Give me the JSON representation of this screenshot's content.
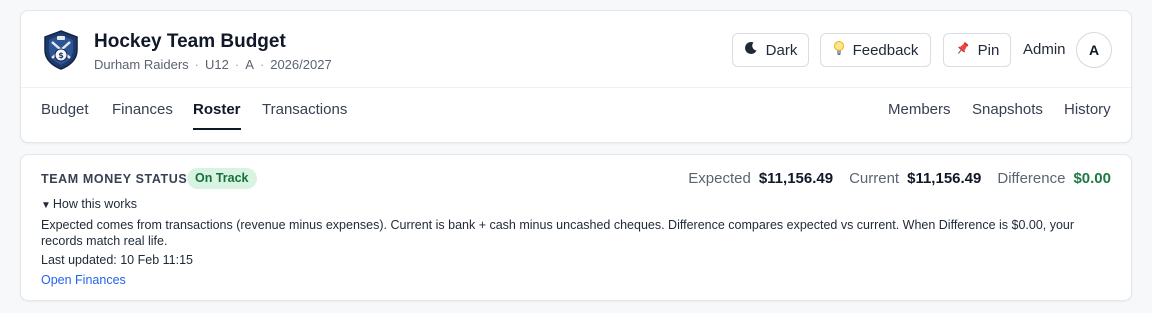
{
  "header": {
    "title": "Hockey Team Budget",
    "team": "Durham Raiders",
    "division": "U12",
    "tier": "A",
    "season": "2026/2027",
    "separator": "·",
    "buttons": {
      "dark": {
        "label": "Dark",
        "icon": "moon-icon"
      },
      "feedback": {
        "label": "Feedback",
        "icon": "lightbulb-icon"
      },
      "pin": {
        "label": "Pin",
        "icon": "pushpin-icon"
      }
    },
    "role": "Admin",
    "avatar_initial": "A"
  },
  "nav": {
    "left": [
      {
        "label": "Budget",
        "active": false
      },
      {
        "label": "Finances",
        "active": false
      },
      {
        "label": "Roster",
        "active": true
      },
      {
        "label": "Transactions",
        "active": false
      }
    ],
    "right": [
      {
        "label": "Members"
      },
      {
        "label": "Snapshots"
      },
      {
        "label": "History"
      }
    ]
  },
  "status": {
    "label": "TEAM MONEY STATUS",
    "badge": "On Track",
    "expected_label": "Expected",
    "expected_value": "$11,156.49",
    "current_label": "Current",
    "current_value": "$11,156.49",
    "difference_label": "Difference",
    "difference_value": "$0.00",
    "how_title": "How this works",
    "explanation": "Expected comes from transactions (revenue minus expenses). Current is bank + cash minus uncashed cheques. Difference compares expected vs current. When Difference is $0.00, your records match real life.",
    "last_updated": "Last updated: 10 Feb 11:15",
    "link": "Open Finances"
  },
  "colors": {
    "accent_link": "#2563eb",
    "badge_bg": "#d9f3e2",
    "badge_text": "#14703b",
    "difference_positive": "#1e7a45"
  }
}
